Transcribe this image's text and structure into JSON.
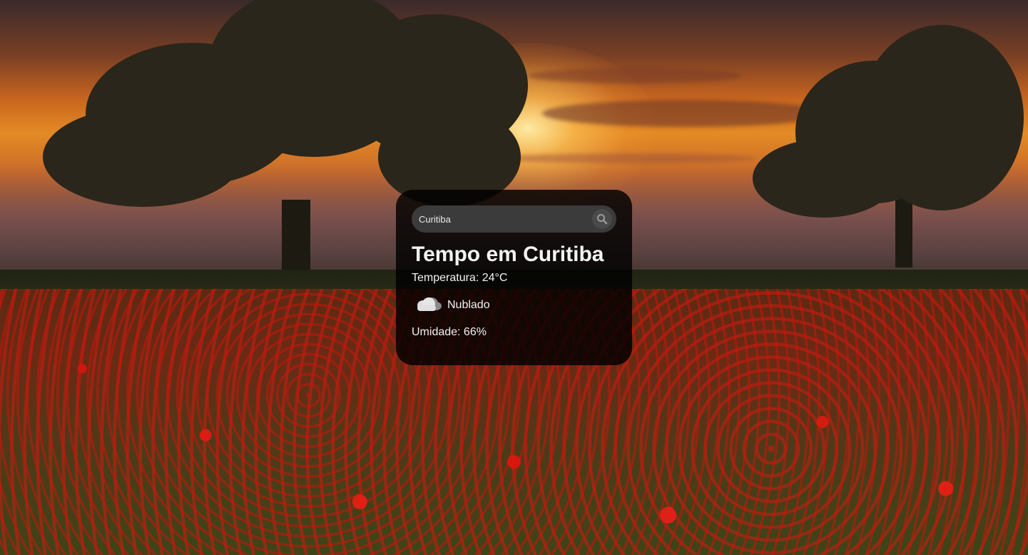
{
  "search": {
    "value": "Curitiba",
    "placeholder": "",
    "button_icon": "search-icon"
  },
  "weather": {
    "title": "Tempo em Curitiba",
    "temperature": "Temperatura: 24°C",
    "condition_icon": "cloud-icon",
    "condition": "Nublado",
    "humidity": "Umidade: 66%"
  },
  "background": {
    "description_icon": "landscape-background"
  },
  "colors": {
    "card_background": "#000000",
    "search_background": "#3b3b3b",
    "text": "#f2f2f2"
  }
}
